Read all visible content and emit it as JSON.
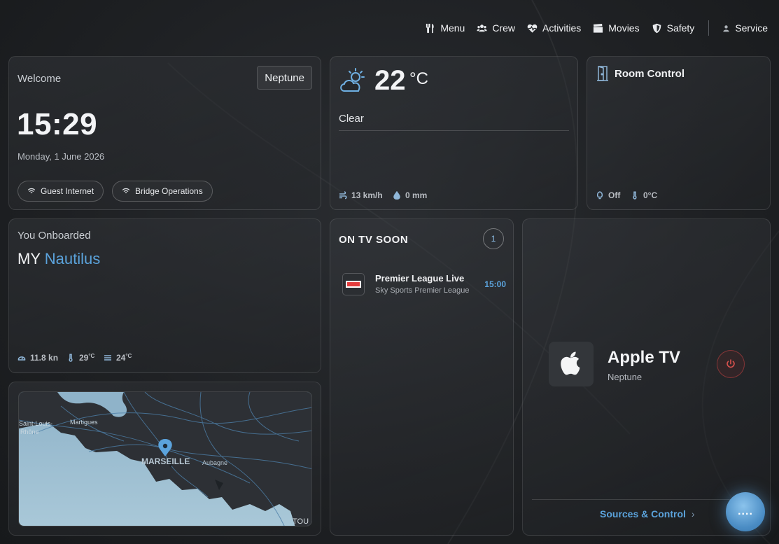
{
  "nav": {
    "items": [
      {
        "label": "Menu",
        "icon": "cutlery-icon"
      },
      {
        "label": "Crew",
        "icon": "people-icon"
      },
      {
        "label": "Activities",
        "icon": "heartbeat-icon"
      },
      {
        "label": "Movies",
        "icon": "clapperboard-icon"
      },
      {
        "label": "Safety",
        "icon": "shield-icon"
      }
    ],
    "service": {
      "label": "Service",
      "icon": "person-icon"
    }
  },
  "welcome": {
    "label": "Welcome",
    "name": "Neptune",
    "time": "15:29",
    "date": "Monday, 1 June 2026",
    "pills": [
      {
        "label": "Guest Internet",
        "icon": "wifi-icon"
      },
      {
        "label": "Bridge Operations",
        "icon": "wifi-icon"
      }
    ]
  },
  "weather": {
    "temperature": "22",
    "unit": "°C",
    "condition": "Clear",
    "wind": "13 km/h",
    "rain": "0 mm"
  },
  "room_control": {
    "title": "Room Control",
    "light": "Off",
    "temperature": "0°C"
  },
  "onboard": {
    "label": "You Onboarded",
    "prefix": "MY",
    "yacht_name": "Nautilus",
    "speed": "11.8 kn",
    "air_temp": "29",
    "air_temp_unit": "°C",
    "water_temp": "24",
    "water_temp_unit": "°C"
  },
  "map": {
    "labels": {
      "city": "MARSEILLE",
      "town1": "Aubagne",
      "town2": "Martigues",
      "town3": "Saint-Louis-",
      "town3b": "Rhône",
      "edge": "TOU"
    }
  },
  "tv_soon": {
    "title": "ON TV SOON",
    "count": "1",
    "programs": [
      {
        "name": "Premier League Live",
        "channel": "Sky Sports Premier League",
        "time": "15:00"
      }
    ]
  },
  "apple_tv": {
    "name": "Apple TV",
    "room": "Neptune",
    "sources_label": "Sources & Control",
    "chevron": "›"
  },
  "fab": {
    "label": "...."
  },
  "colors": {
    "accent": "#5ba3dc",
    "power": "#d9514d",
    "background": "#1f2124"
  }
}
